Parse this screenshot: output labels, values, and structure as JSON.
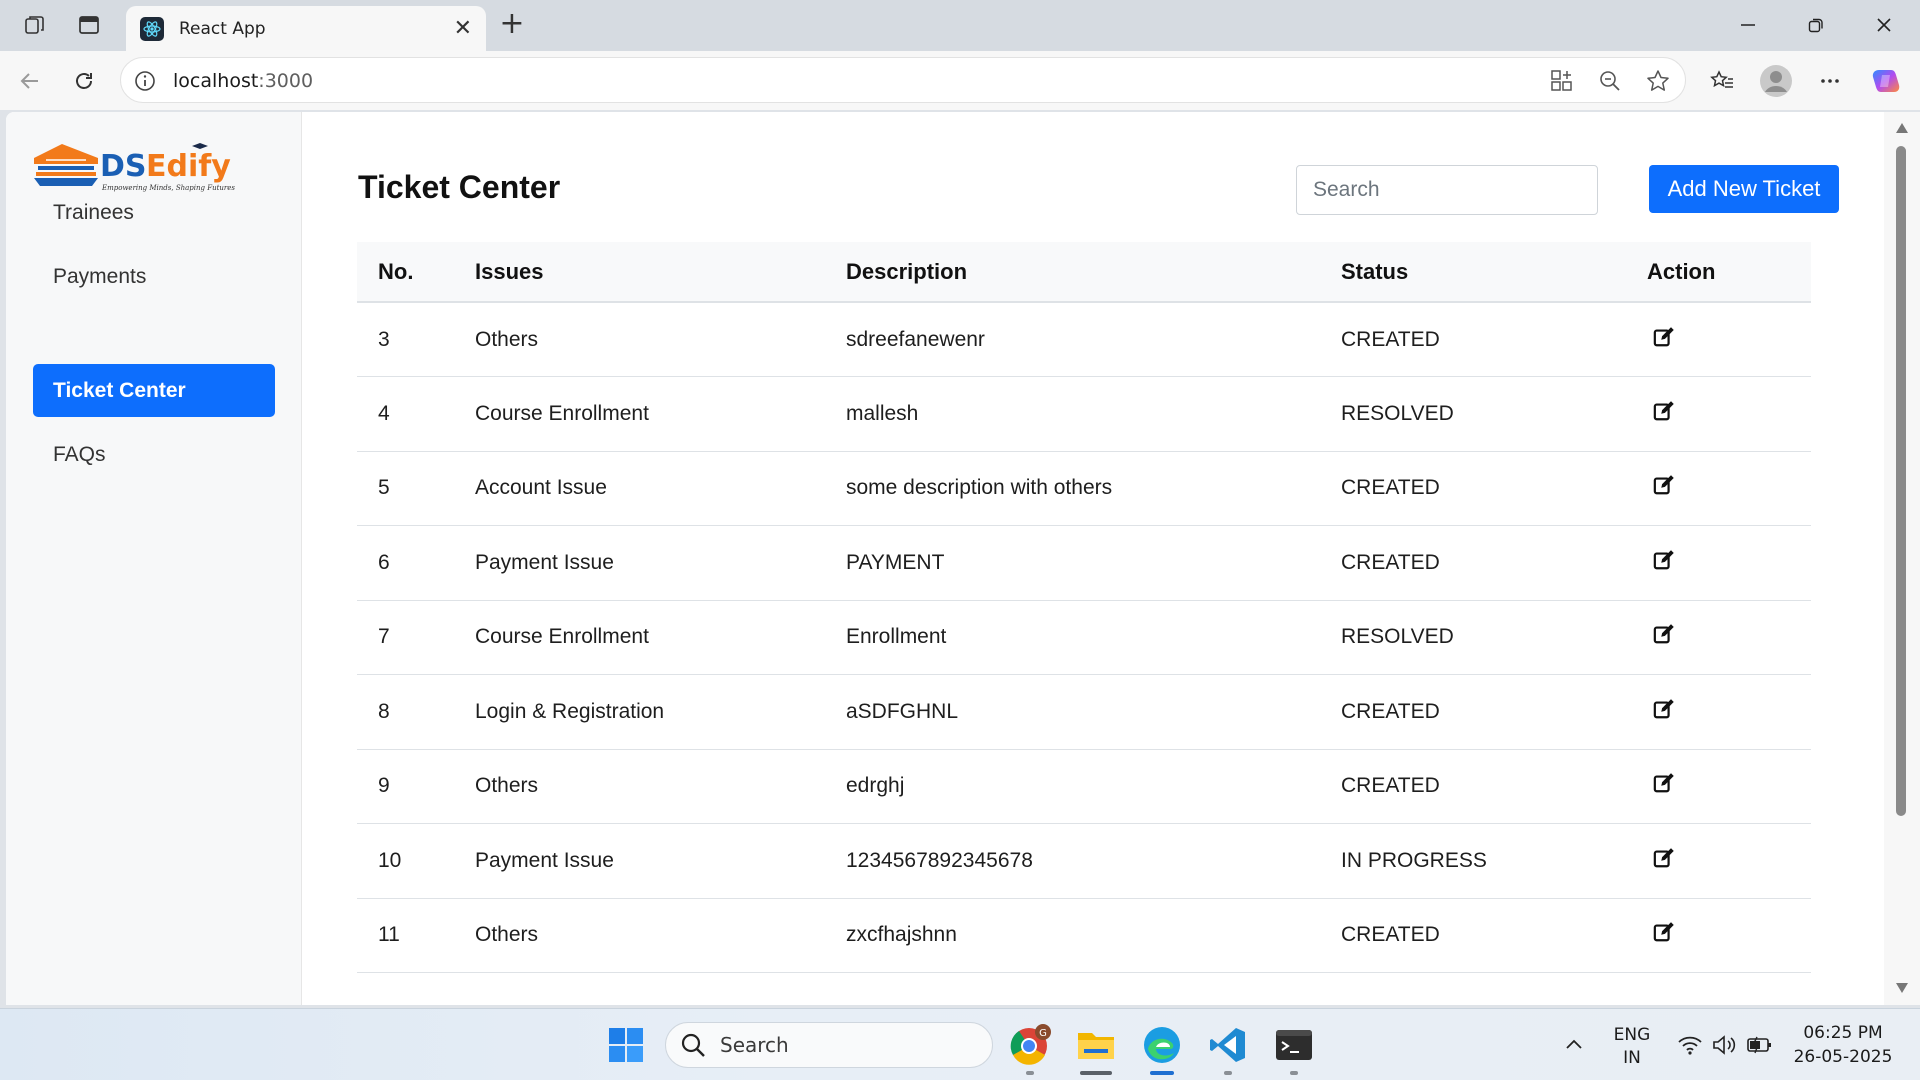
{
  "browser": {
    "tab_title": "React App",
    "url_host": "localhost",
    "url_port": ":3000"
  },
  "sidebar": {
    "logo_name": "DSEdify",
    "logo_tagline": "Empowering Minds, Shaping Futures",
    "items": [
      {
        "label": "Trainees"
      },
      {
        "label": "Payments"
      },
      {
        "label": "Ticket Center",
        "active": true
      },
      {
        "label": "FAQs"
      }
    ]
  },
  "main": {
    "title": "Ticket Center",
    "search_placeholder": "Search",
    "add_button_label": "Add New Ticket",
    "columns": [
      "No.",
      "Issues",
      "Description",
      "Status",
      "Action"
    ],
    "rows": [
      {
        "no": "3",
        "issue": "Others",
        "description": "sdreefanewenr",
        "status": "CREATED"
      },
      {
        "no": "4",
        "issue": "Course Enrollment",
        "description": "mallesh",
        "status": "RESOLVED"
      },
      {
        "no": "5",
        "issue": "Account Issue",
        "description": "some description with others",
        "status": "CREATED"
      },
      {
        "no": "6",
        "issue": "Payment Issue",
        "description": "PAYMENT",
        "status": "CREATED"
      },
      {
        "no": "7",
        "issue": "Course Enrollment",
        "description": "Enrollment",
        "status": "RESOLVED"
      },
      {
        "no": "8",
        "issue": "Login & Registration",
        "description": "aSDFGHNL",
        "status": "CREATED"
      },
      {
        "no": "9",
        "issue": "Others",
        "description": "edrghj",
        "status": "CREATED"
      },
      {
        "no": "10",
        "issue": "Payment Issue",
        "description": "1234567892345678",
        "status": "IN PROGRESS"
      },
      {
        "no": "11",
        "issue": "Others",
        "description": "zxcfhajshnn",
        "status": "CREATED"
      }
    ]
  },
  "taskbar": {
    "search_label": "Search",
    "lang_top": "ENG",
    "lang_bottom": "IN",
    "time": "06:25 PM",
    "date": "26-05-2025",
    "chrome_badge": "G"
  },
  "colors": {
    "accent": "#0d6efd",
    "logo_blue": "#1a5fb4",
    "logo_orange": "#f27a1a"
  },
  "icons": [
    "collections-icon",
    "tab-actions-icon",
    "react-icon",
    "close-tab-icon",
    "new-tab-icon",
    "minimize-icon",
    "restore-icon",
    "close-window-icon",
    "back-icon",
    "refresh-icon",
    "site-info-icon",
    "app-available-icon",
    "zoom-out-icon",
    "favorite-star-icon",
    "favorites-icon",
    "profile-icon",
    "more-icon",
    "copilot-icon",
    "edit-icon",
    "windows-start-icon",
    "search-icon",
    "chrome-icon",
    "file-explorer-icon",
    "edge-icon",
    "vscode-icon",
    "terminal-icon",
    "chevron-up-icon",
    "wifi-icon",
    "volume-icon",
    "battery-icon"
  ]
}
